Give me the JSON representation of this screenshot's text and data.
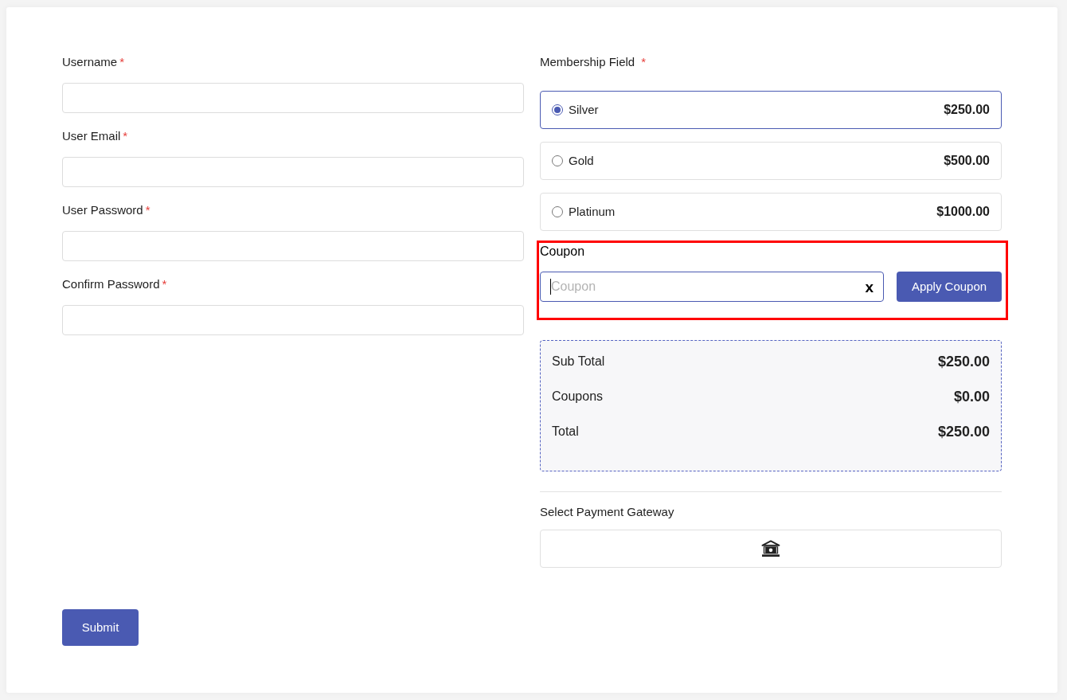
{
  "account_fields": [
    {
      "label": "Username",
      "required_mark": "*"
    },
    {
      "label": "User Email",
      "required_mark": "*"
    },
    {
      "label": "User Password",
      "required_mark": "*"
    },
    {
      "label": "Confirm Password",
      "required_mark": "*"
    }
  ],
  "membership": {
    "label": "Membership Field",
    "required_mark": "*",
    "options": [
      {
        "name": "Silver",
        "price": "$250.00",
        "selected": true
      },
      {
        "name": "Gold",
        "price": "$500.00",
        "selected": false
      },
      {
        "name": "Platinum",
        "price": "$1000.00",
        "selected": false
      }
    ]
  },
  "coupon": {
    "label": "Coupon",
    "placeholder": "Coupon",
    "focused": true,
    "highlighted": true,
    "clear_label": "x",
    "button": "Apply Coupon"
  },
  "summary": [
    {
      "label": "Sub Total",
      "value": "$250.00"
    },
    {
      "label": "Coupons",
      "value": "$0.00"
    },
    {
      "label": "Total",
      "value": "$250.00"
    }
  ],
  "payment": {
    "label": "Select Payment Gateway",
    "gateways": [
      {
        "kind": "bank"
      }
    ]
  },
  "submit_button": "Submit"
}
